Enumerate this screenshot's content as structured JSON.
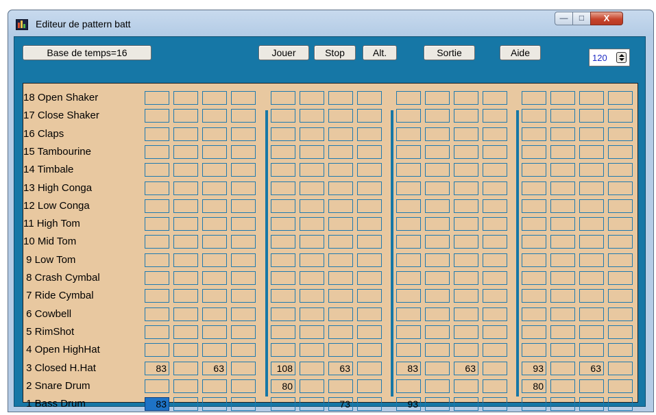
{
  "window": {
    "title": "Editeur de pattern batt",
    "controls": {
      "minimize": "—",
      "maximize": "□",
      "close": "X"
    }
  },
  "toolbar": {
    "timebase_label": "Base de temps=16",
    "play_label": "Jouer",
    "stop_label": "Stop",
    "alt_label": "Alt.",
    "exit_label": "Sortie",
    "help_label": "Aide",
    "tempo_value": "120"
  },
  "instruments": [
    {
      "label": "18 Open Shaker",
      "values": [
        "",
        "",
        "",
        "",
        "",
        "",
        "",
        "",
        "",
        "",
        "",
        "",
        "",
        "",
        "",
        ""
      ]
    },
    {
      "label": "17 Close Shaker",
      "values": [
        "",
        "",
        "",
        "",
        "",
        "",
        "",
        "",
        "",
        "",
        "",
        "",
        "",
        "",
        "",
        ""
      ]
    },
    {
      "label": "16 Claps",
      "values": [
        "",
        "",
        "",
        "",
        "",
        "",
        "",
        "",
        "",
        "",
        "",
        "",
        "",
        "",
        "",
        ""
      ]
    },
    {
      "label": "15 Tambourine",
      "values": [
        "",
        "",
        "",
        "",
        "",
        "",
        "",
        "",
        "",
        "",
        "",
        "",
        "",
        "",
        "",
        ""
      ]
    },
    {
      "label": "14 Timbale",
      "values": [
        "",
        "",
        "",
        "",
        "",
        "",
        "",
        "",
        "",
        "",
        "",
        "",
        "",
        "",
        "",
        ""
      ]
    },
    {
      "label": "13 High Conga",
      "values": [
        "",
        "",
        "",
        "",
        "",
        "",
        "",
        "",
        "",
        "",
        "",
        "",
        "",
        "",
        "",
        ""
      ]
    },
    {
      "label": "12 Low Conga",
      "values": [
        "",
        "",
        "",
        "",
        "",
        "",
        "",
        "",
        "",
        "",
        "",
        "",
        "",
        "",
        "",
        ""
      ]
    },
    {
      "label": "11 High Tom",
      "values": [
        "",
        "",
        "",
        "",
        "",
        "",
        "",
        "",
        "",
        "",
        "",
        "",
        "",
        "",
        "",
        ""
      ]
    },
    {
      "label": "10 Mid Tom",
      "values": [
        "",
        "",
        "",
        "",
        "",
        "",
        "",
        "",
        "",
        "",
        "",
        "",
        "",
        "",
        "",
        ""
      ]
    },
    {
      "label": " 9 Low Tom",
      "values": [
        "",
        "",
        "",
        "",
        "",
        "",
        "",
        "",
        "",
        "",
        "",
        "",
        "",
        "",
        "",
        ""
      ]
    },
    {
      "label": " 8 Crash Cymbal",
      "values": [
        "",
        "",
        "",
        "",
        "",
        "",
        "",
        "",
        "",
        "",
        "",
        "",
        "",
        "",
        "",
        ""
      ]
    },
    {
      "label": " 7 Ride Cymbal",
      "values": [
        "",
        "",
        "",
        "",
        "",
        "",
        "",
        "",
        "",
        "",
        "",
        "",
        "",
        "",
        "",
        ""
      ]
    },
    {
      "label": " 6 Cowbell",
      "values": [
        "",
        "",
        "",
        "",
        "",
        "",
        "",
        "",
        "",
        "",
        "",
        "",
        "",
        "",
        "",
        ""
      ]
    },
    {
      "label": " 5 RimShot",
      "values": [
        "",
        "",
        "",
        "",
        "",
        "",
        "",
        "",
        "",
        "",
        "",
        "",
        "",
        "",
        "",
        ""
      ]
    },
    {
      "label": " 4 Open HighHat",
      "values": [
        "",
        "",
        "",
        "",
        "",
        "",
        "",
        "",
        "",
        "",
        "",
        "",
        "",
        "",
        "",
        ""
      ]
    },
    {
      "label": " 3 Closed H.Hat",
      "values": [
        "83",
        "",
        "63",
        "",
        "108",
        "",
        "63",
        "",
        "83",
        "",
        "63",
        "",
        "93",
        "",
        "63",
        ""
      ]
    },
    {
      "label": " 2 Snare Drum",
      "values": [
        "",
        "",
        "",
        "",
        "80",
        "",
        "",
        "",
        "",
        "",
        "",
        "",
        "80",
        "",
        "",
        ""
      ]
    },
    {
      "label": " 1 Bass Drum",
      "values": [
        "83",
        "",
        "",
        "",
        "",
        "",
        "73",
        "",
        "93",
        "",
        "",
        "",
        "",
        "",
        "",
        ""
      ]
    }
  ],
  "selected_cell": {
    "row": 17,
    "step": 0
  },
  "colors": {
    "grid_background": "#e8c8a0",
    "cell_border": "#1e7ab0",
    "selected_cell": "#1e73c6",
    "client_background": "#1677a6"
  }
}
